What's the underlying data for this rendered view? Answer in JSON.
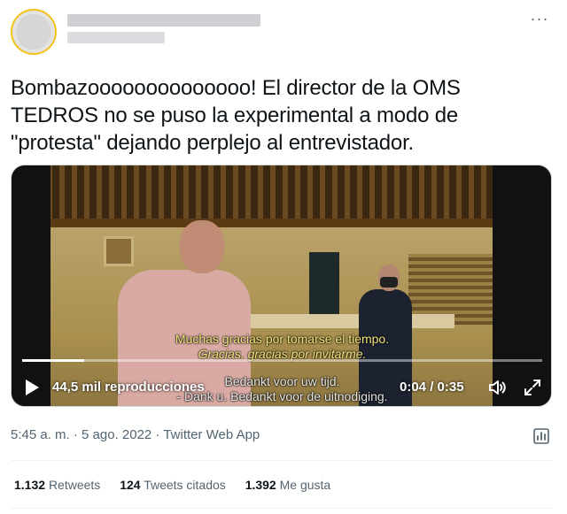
{
  "header": {
    "display_name": "",
    "handle": "",
    "more_glyph": "···"
  },
  "tweet": {
    "text": "Bombazoooooooooooooo! El director de la OMS\nTEDROS no se puso la experimental a modo de\n\"protesta\" dejando perplejo al entrevistador."
  },
  "video": {
    "subtitle_line1": "Muchas gracias por tomarse el tiempo.",
    "subtitle_line2": "Gracias, gracias por invitarme.",
    "subtitle_line3": "Bedankt voor uw tijd.",
    "subtitle_line4": "- Dank u. Bedankt voor de uitnodiging.",
    "views": "44,5 mil reproducciones",
    "time": "0:04 / 0:35",
    "progress_fraction": 0.12,
    "icons": [
      "play-icon",
      "volume-icon",
      "fullscreen-icon"
    ]
  },
  "meta": {
    "timestamp": "5:45 a. m. · 5 ago. 2022 · Twitter Web App",
    "analytics_icon": "analytics-icon"
  },
  "stats": [
    {
      "num": "1.132",
      "label": "Retweets"
    },
    {
      "num": "124",
      "label": "Tweets citados"
    },
    {
      "num": "1.392",
      "label": "Me gusta"
    }
  ],
  "colors": {
    "text_primary": "#0f1419",
    "text_secondary": "#536471",
    "subtitle_yellow": "#f3e47a"
  }
}
